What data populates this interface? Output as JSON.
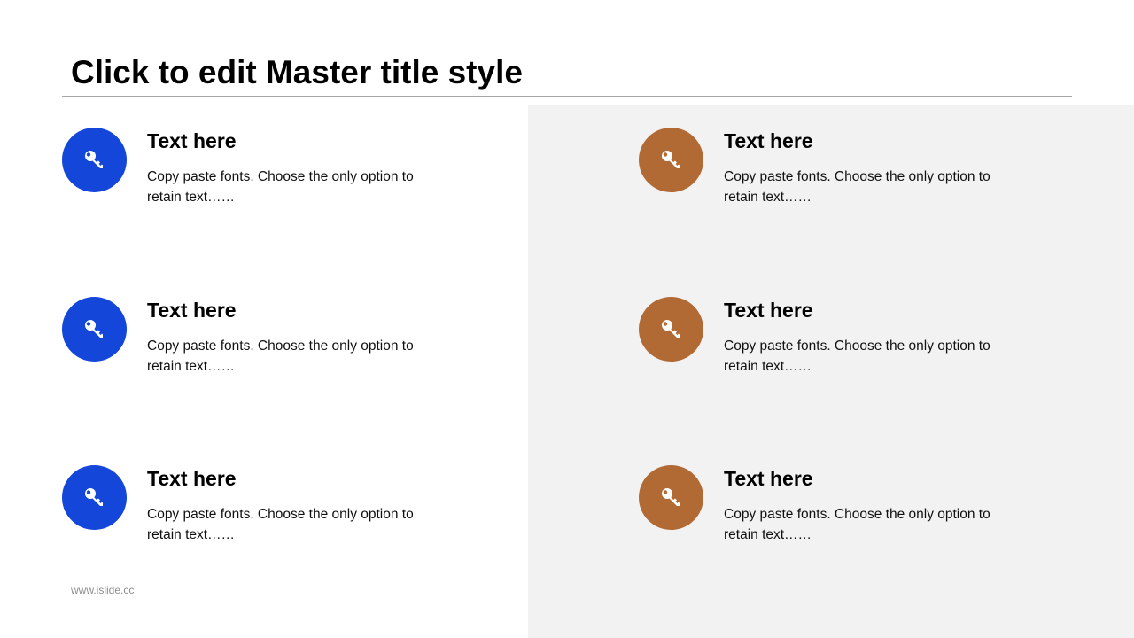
{
  "slide": {
    "title": "Click to edit Master title style",
    "footer": "www.islide.cc"
  },
  "colors": {
    "left_accent": "#1447d9",
    "right_accent": "#b26a35",
    "panel_background": "#f2f2f2"
  },
  "left_column": {
    "items": [
      {
        "icon": "key-icon",
        "heading": "Text here",
        "body": "Copy paste fonts. Choose the only option to retain text……"
      },
      {
        "icon": "key-icon",
        "heading": "Text here",
        "body": "Copy paste fonts. Choose the only option to retain text……"
      },
      {
        "icon": "key-icon",
        "heading": "Text here",
        "body": "Copy paste fonts. Choose the only option to retain text……"
      }
    ]
  },
  "right_column": {
    "items": [
      {
        "icon": "key-icon",
        "heading": "Text here",
        "body": "Copy paste fonts. Choose the only option to retain text……"
      },
      {
        "icon": "key-icon",
        "heading": "Text here",
        "body": "Copy paste fonts. Choose the only option to retain text……"
      },
      {
        "icon": "key-icon",
        "heading": "Text here",
        "body": "Copy paste fonts. Choose the only option to retain text……"
      }
    ]
  }
}
